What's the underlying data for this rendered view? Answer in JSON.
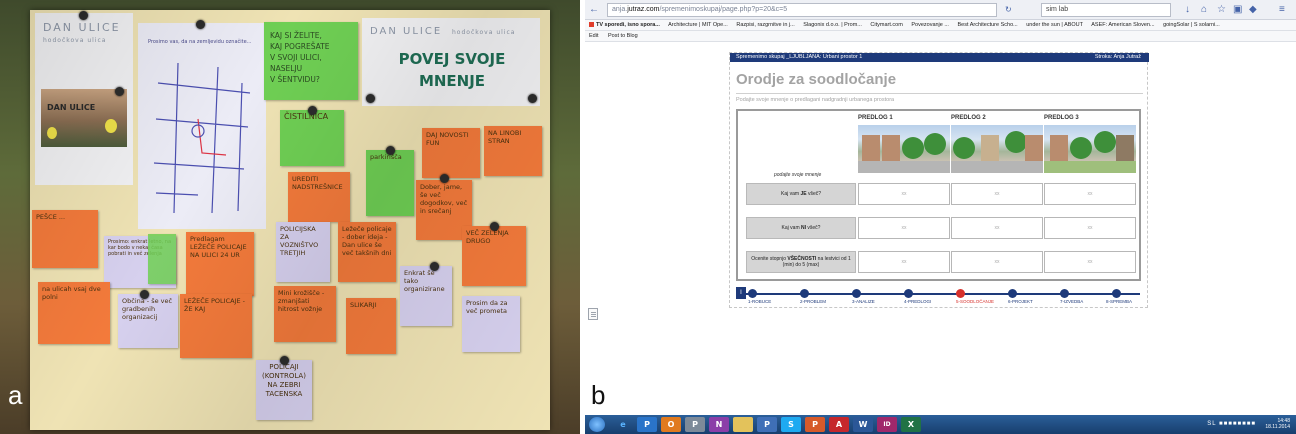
{
  "panel_a": {
    "label": "a",
    "poster_left": {
      "title": "DAN ULICE",
      "subtitle": "hodočkova ulica",
      "photo_caption": "DAN ULICE"
    },
    "poster_right": {
      "title": "DAN ULICE",
      "subtitle": "hodočkova ulica",
      "headline_1": "POVEJ SVOJE",
      "headline_2": "MNENJE"
    },
    "green_question": [
      "KAJ SI ŽELITE,",
      "KAJ POGREŠATE",
      "V SVOJI ULICI, NASELJU",
      "V ŠENTVIDU?"
    ],
    "map_caption": "Prosimo vas, da na zemljevidu označite...",
    "notes": {
      "cistilnica": "ČISTILNICA",
      "urediti": "UREDITI NADSTREŠNICE",
      "fun": "DAJ NOVOSTI FUN",
      "nalinobi": "NA LINOBI STRAN",
      "pesce": "PEŠCE ...",
      "dober": "Dober, jame, še več dogodkov, več in srečanj",
      "parkirisca": "parkirišča",
      "prosimo": "Prosimo: enkrat letno, na kar bodo v nekaj časa pobrati in več zelenja",
      "predlagam": "Predlagam LEŽEČE POLICAJE NA ULICI 24 UR",
      "policijska": "POLICIJSKA ZA VOZNIŠTVO TRETJIH",
      "lezece_1": "Ležeče policaje - dober ideja - Dan ulice še več takšnih dni",
      "vec_zelenja": "VEČ ZELENJA DRUGO",
      "enkrat": "Enkrat še tako organizirane",
      "obcina": "Občina - še več gradbenih organizacij",
      "lezece_2": "LEŽEČE POLICAJE - ŽE KAJ",
      "mini": "Mini krožišče - zmanjšati hitrost vožnje",
      "slikarji": "SLIKARJI",
      "policaji": "POLICAJI (KONTROLA) NA ZEBRI TACENSKA",
      "na_ulicah": "na ulicah vsaj dve polni",
      "roza": "Prosim da za več prometa"
    }
  },
  "panel_b": {
    "label": "b",
    "browser": {
      "url_prefix": "anja.",
      "url_domain": "jutraz.com",
      "url_rest": "/spremenimoskupaj/page.php?p=20&c=5",
      "search_text": "sim lab",
      "bookmarks": [
        "TV sporedi, isno spora...",
        "Architecture | MIT Ope...",
        "Razpisi, razgrnitve in j...",
        "Slagonix d.o.o. | Prom...",
        "Citymart.com",
        "Povezovanje ...",
        "Best Architecture Scho...",
        "under the sun | ABOUT",
        "ASEF: American Sloven...",
        "goingSolar | S solarni..."
      ],
      "toolbar2": [
        "Edit",
        "Post to Blog"
      ]
    },
    "page": {
      "header_left": "Spremenimo skupaj _LJUBLJANA:  Urbani prostor 1",
      "header_right": "Stroka:  Anja Jutraž",
      "title": "Orodje za soodločanje",
      "subtitle": "Podajte svoje mnenje o predlagani nadgradnji urbanega prostora",
      "hint": "podajte svoje mnenje",
      "columns": [
        "PREDLOG 1",
        "PREDLOG 2",
        "PREDLOG 3"
      ],
      "rows": [
        {
          "label_pre": "Kaj vam ",
          "label_bold": "JE",
          "label_post": " všeč?"
        },
        {
          "label_pre": "Kaj vam ",
          "label_bold": "NI",
          "label_post": " všeč?"
        },
        {
          "label_pre": "Ocenite stopnjo ",
          "label_bold": "VŠEČNOSTI",
          "label_post": " na lestvici od 1 (min) do 5 (max)"
        }
      ],
      "cell_placeholder": "xx",
      "progress_start": "I",
      "steps": [
        "1-ROBUCE",
        "2-PROBLEM",
        "3-ANALIZE",
        "4-PREDLOGI",
        "5-SOODLOČANJE",
        "6-PROJEKT",
        "7-IZVEDBA",
        "8-SPREMBA"
      ],
      "active_step": 4
    },
    "taskbar": {
      "time": "14:48",
      "date": "18.11.2014",
      "tray_lang": "SL",
      "icons": [
        "start",
        "e",
        "P",
        "O",
        "P",
        "N",
        "P",
        "S",
        "A",
        "P",
        "W",
        "ID",
        "X"
      ]
    }
  },
  "colors": {
    "navy": "#1e3a7a",
    "active_red": "#d6312c",
    "note_orange": "#f37a3b",
    "note_green": "#6fcf54",
    "note_lilac": "#d6d0ee"
  }
}
